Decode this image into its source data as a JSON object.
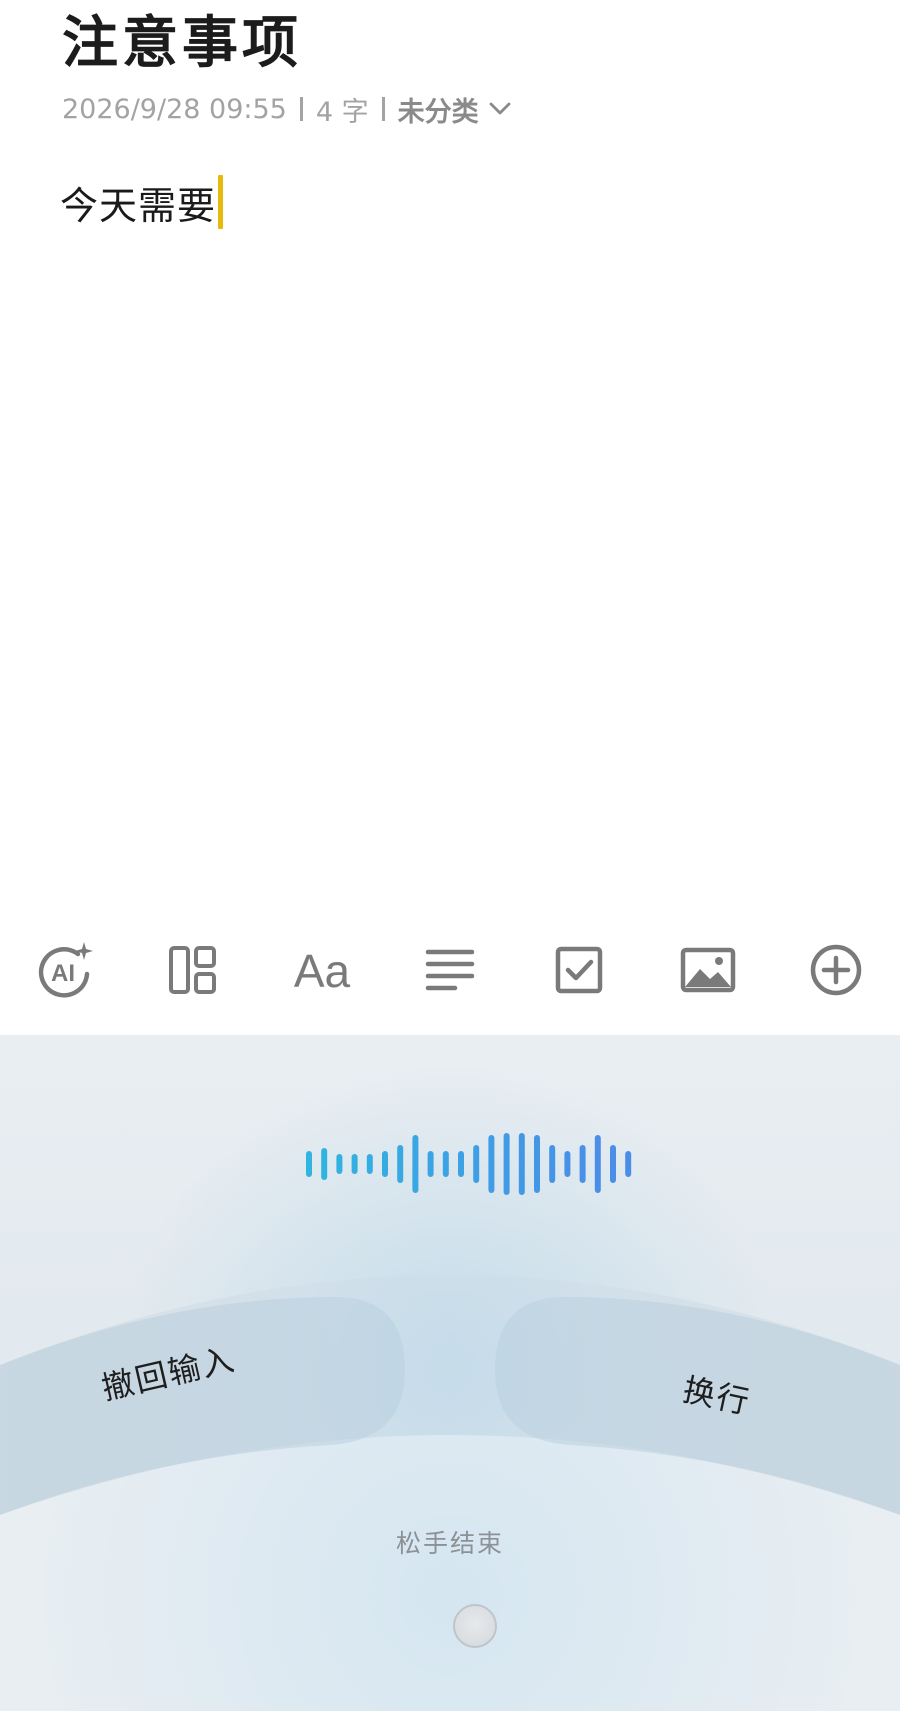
{
  "note": {
    "title": "注意事项",
    "date": "2026/9/28 09:55",
    "word_count": "4 字",
    "category": "未分类",
    "body": "今天需要"
  },
  "toolbar": {
    "items": [
      {
        "name": "ai-assistant",
        "icon": "ai-sparkle-icon"
      },
      {
        "name": "layout",
        "icon": "layout-grid-icon"
      },
      {
        "name": "text-format",
        "icon": "text-format-icon"
      },
      {
        "name": "paragraph-align",
        "icon": "align-left-icon"
      },
      {
        "name": "checklist",
        "icon": "checkbox-icon"
      },
      {
        "name": "insert-image",
        "icon": "image-icon"
      },
      {
        "name": "add-more",
        "icon": "plus-circle-icon"
      }
    ]
  },
  "voice": {
    "undo_label": "撤回输入",
    "newline_label": "换行",
    "release_hint": "松手结束"
  },
  "colors": {
    "cursor": "#e8b90d",
    "wave_start": "#2fb6e0",
    "wave_end": "#4a8ee8",
    "meta_text": "#a3a3a3",
    "icon_gray": "#7a7a7a"
  }
}
